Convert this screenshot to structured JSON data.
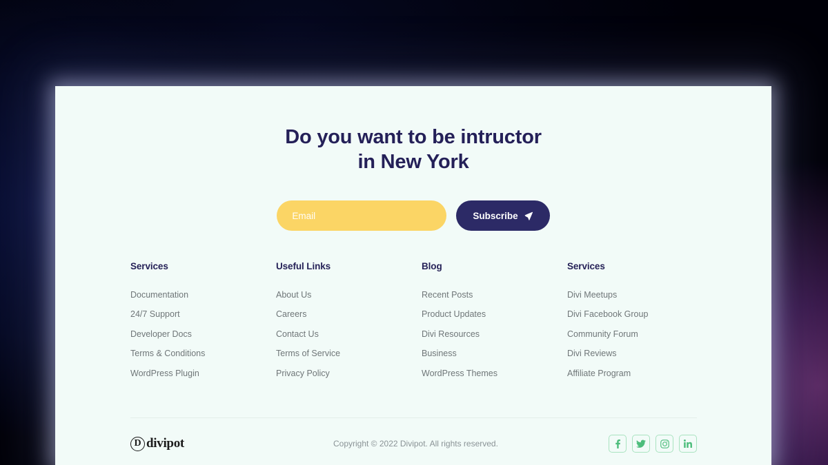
{
  "theme": {
    "panel_bg": "#f2fbf8",
    "heading_color": "#242058",
    "accent_yellow": "#fbd565",
    "accent_navy": "#2c2a66",
    "link_color": "#6f7678",
    "social_green": "#4dbd7c"
  },
  "hero": {
    "title_line1": "Do you want to be intructor",
    "title_line2": "in New York"
  },
  "subscribe": {
    "email_placeholder": "Email",
    "email_value": "",
    "button_label": "Subscribe",
    "button_icon": "send-icon"
  },
  "columns": [
    {
      "title": "Services",
      "links": [
        "Documentation",
        "24/7 Support",
        "Developer Docs",
        "Terms & Conditions",
        "WordPress Plugin"
      ]
    },
    {
      "title": "Useful Links",
      "links": [
        "About Us",
        "Careers",
        "Contact Us",
        "Terms of Service",
        "Privacy Policy"
      ]
    },
    {
      "title": "Blog",
      "links": [
        "Recent Posts",
        "Product Updates",
        "Divi Resources",
        "Business",
        "WordPress Themes"
      ]
    },
    {
      "title": "Services",
      "links": [
        "Divi Meetups",
        "Divi Facebook Group",
        "Community Forum",
        "Divi Reviews",
        "Affiliate Program"
      ]
    }
  ],
  "bottom": {
    "logo_mark": "D",
    "logo_word": "divipot",
    "copyright": "Copyright © 2022 Divipot. All rights reserved.",
    "socials": [
      {
        "name": "facebook-icon",
        "label": "Facebook"
      },
      {
        "name": "twitter-icon",
        "label": "Twitter"
      },
      {
        "name": "instagram-icon",
        "label": "Instagram"
      },
      {
        "name": "linkedin-icon",
        "label": "LinkedIn"
      }
    ]
  }
}
